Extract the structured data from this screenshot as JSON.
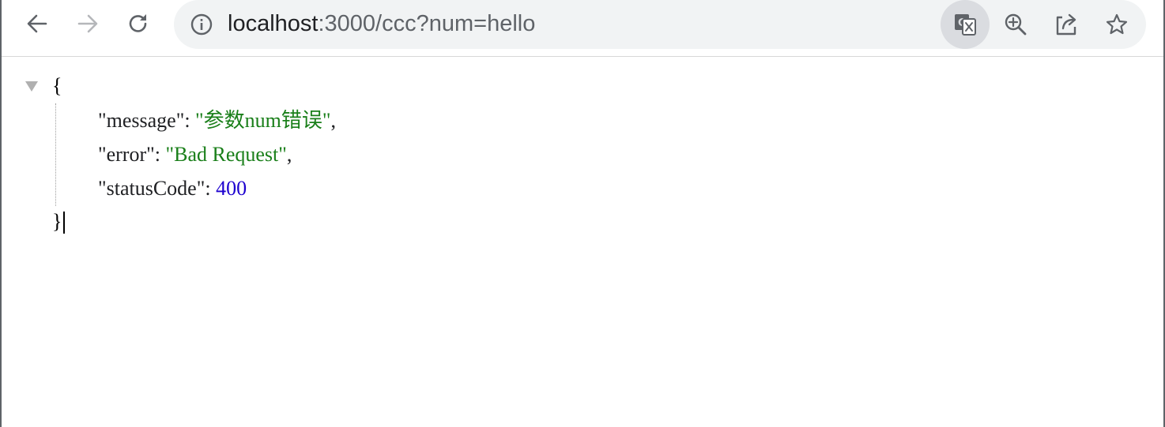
{
  "toolbar": {
    "url_host": "localhost",
    "url_path": ":3000/ccc?num=hello",
    "icons": {
      "back": "arrow-left-icon",
      "forward": "arrow-right-icon",
      "reload": "reload-icon",
      "info": "info-icon",
      "translate": "translate-icon",
      "zoom": "zoom-in-icon",
      "share": "share-icon",
      "bookmark": "star-icon"
    }
  },
  "json": {
    "open_brace": "{",
    "close_brace": "}",
    "fields": [
      {
        "key": "\"message\"",
        "sep": ": ",
        "value": "\"参数num错误\"",
        "trail": ","
      },
      {
        "key": "\"error\"",
        "sep": ": ",
        "value": "\"Bad Request\"",
        "trail": ","
      },
      {
        "key": "\"statusCode\"",
        "sep": ": ",
        "value": "400",
        "trail": ""
      }
    ]
  },
  "colors": {
    "string_value": "#1a7f1a",
    "number_value": "#1c00cf",
    "omnibox_bg": "#f1f3f4"
  }
}
